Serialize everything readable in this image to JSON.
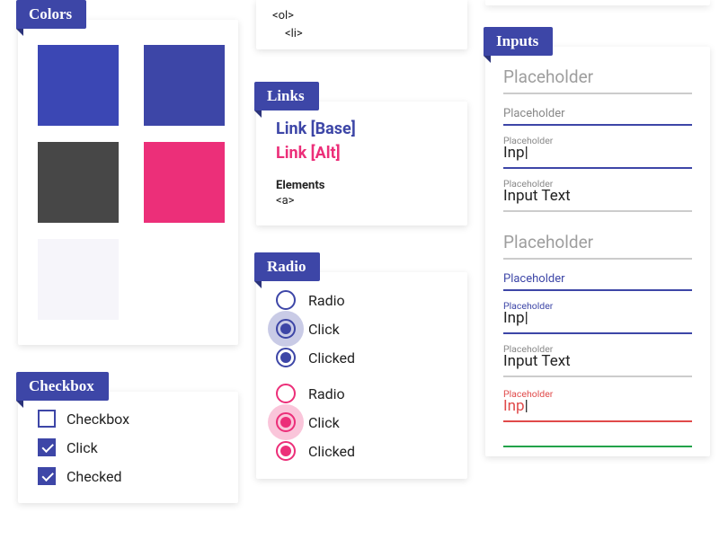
{
  "sections": {
    "colors": {
      "title": "Colors"
    },
    "checkbox": {
      "title": "Checkbox"
    },
    "links": {
      "title": "Links"
    },
    "radio": {
      "title": "Radio"
    },
    "inputs": {
      "title": "Inputs"
    }
  },
  "colors": {
    "swatches": [
      "#3b47b4",
      "#3d46a7",
      "#474747",
      "#ec2f79",
      "#f6f5fa",
      "#ffffff"
    ]
  },
  "checkbox": {
    "items": [
      {
        "label": "Checkbox"
      },
      {
        "label": "Click"
      },
      {
        "label": "Checked"
      }
    ]
  },
  "code_stub": {
    "line1": "<ol>",
    "line2": "<li>"
  },
  "links": {
    "base": "Link [Base]",
    "alt": "Link [Alt]",
    "elements_label": "Elements",
    "a_tag": "<a>"
  },
  "radio": {
    "groups": [
      {
        "color": "#3d46a7",
        "halo": "rgba(61,70,167,0.28)",
        "items": [
          {
            "label": "Radio"
          },
          {
            "label": "Click"
          },
          {
            "label": "Clicked"
          }
        ]
      },
      {
        "color": "#ec2f79",
        "halo": "rgba(236,47,121,0.28)",
        "items": [
          {
            "label": "Radio"
          },
          {
            "label": "Click"
          },
          {
            "label": "Clicked"
          }
        ]
      }
    ]
  },
  "inputs": {
    "placeholder": "Placeholder",
    "inp": "Inp",
    "input_text": "Input Text"
  }
}
